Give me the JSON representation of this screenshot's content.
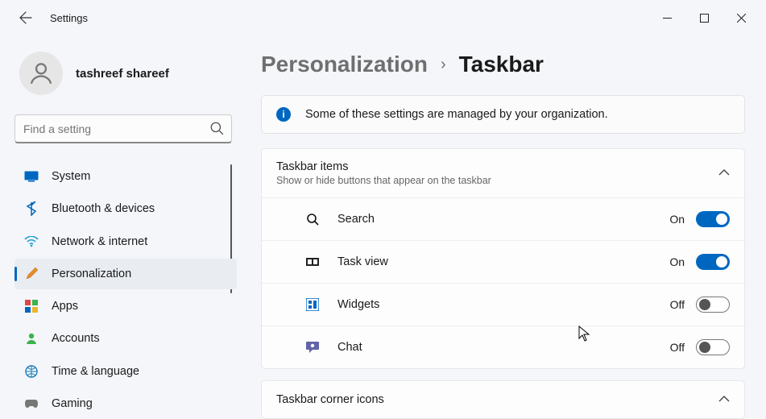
{
  "app": {
    "title": "Settings"
  },
  "user": {
    "name": "tashreef shareef"
  },
  "search": {
    "placeholder": "Find a setting"
  },
  "nav": {
    "items": [
      {
        "label": "System"
      },
      {
        "label": "Bluetooth & devices"
      },
      {
        "label": "Network & internet"
      },
      {
        "label": "Personalization"
      },
      {
        "label": "Apps"
      },
      {
        "label": "Accounts"
      },
      {
        "label": "Time & language"
      },
      {
        "label": "Gaming"
      }
    ]
  },
  "breadcrumb": {
    "parent": "Personalization",
    "current": "Taskbar"
  },
  "banner": {
    "text": "Some of these settings are managed by your organization."
  },
  "sections": {
    "taskbarItems": {
      "title": "Taskbar items",
      "subtitle": "Show or hide buttons that appear on the taskbar",
      "rows": [
        {
          "label": "Search",
          "state": "On",
          "on": true
        },
        {
          "label": "Task view",
          "state": "On",
          "on": true
        },
        {
          "label": "Widgets",
          "state": "Off",
          "on": false
        },
        {
          "label": "Chat",
          "state": "Off",
          "on": false
        }
      ]
    },
    "cornerIcons": {
      "title": "Taskbar corner icons"
    }
  }
}
